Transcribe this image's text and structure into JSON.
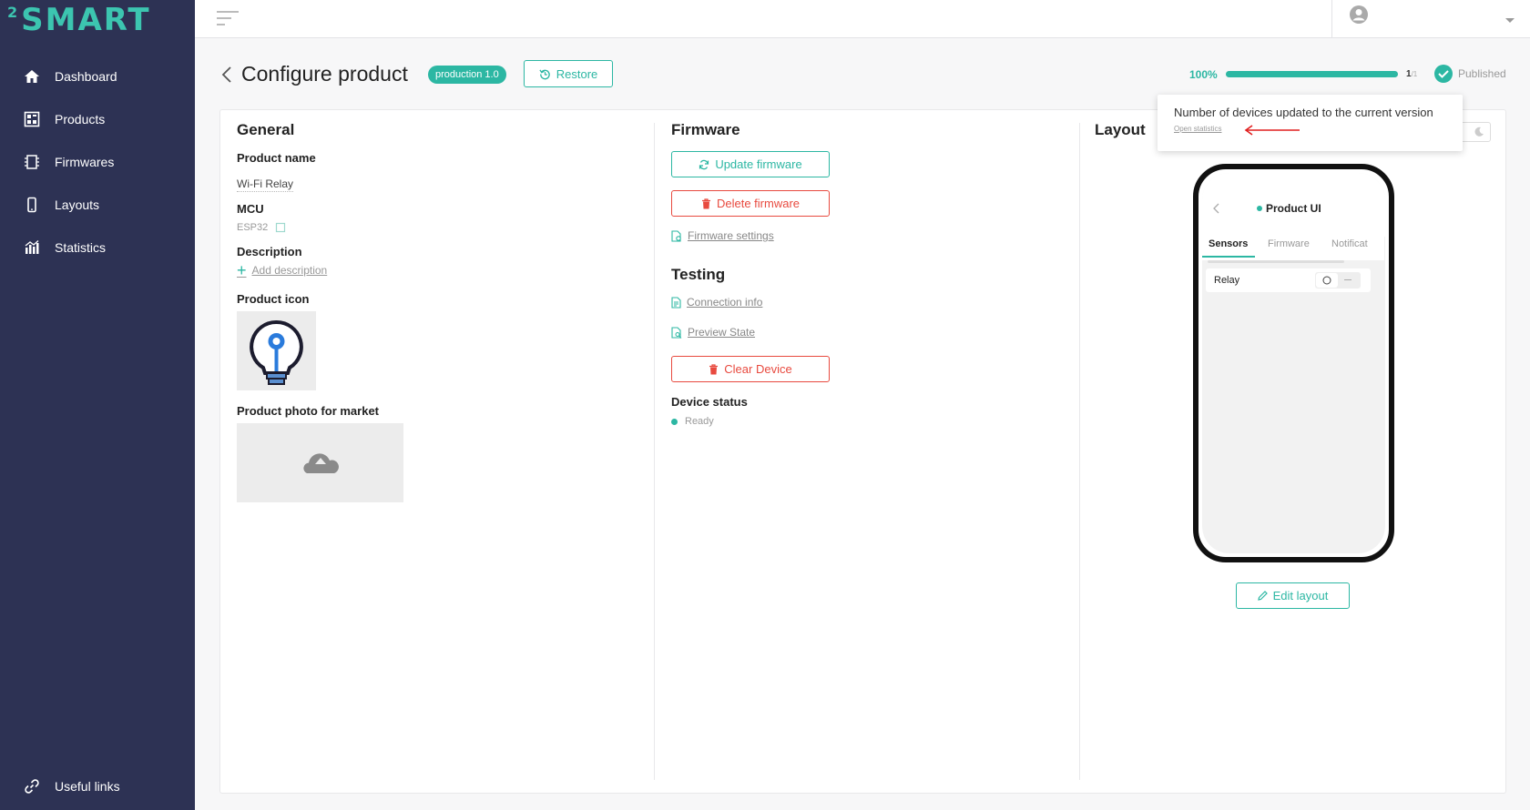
{
  "app": {
    "logo_sup": "2",
    "logo_text": "SMART"
  },
  "sidebar": {
    "items": [
      {
        "label": "Dashboard",
        "icon": "home-icon"
      },
      {
        "label": "Products",
        "icon": "products-icon"
      },
      {
        "label": "Firmwares",
        "icon": "firmware-icon"
      },
      {
        "label": "Layouts",
        "icon": "phone-icon"
      },
      {
        "label": "Statistics",
        "icon": "chart-icon"
      }
    ],
    "footer_link": "Useful links"
  },
  "header": {
    "title": "Configure product",
    "version_badge": "production 1.0",
    "restore_label": "Restore",
    "progress_percent_label": "100%",
    "progress_value": 1.0,
    "progress_count": "1",
    "progress_total": "/1",
    "published_label": "Published"
  },
  "tooltip": {
    "text": "Number of devices updated to the current version",
    "link": "Open statistics"
  },
  "general": {
    "title": "General",
    "product_name_label": "Product name",
    "product_name_value": "Wi-Fi Relay",
    "mcu_label": "MCU",
    "mcu_value": "ESP32",
    "description_label": "Description",
    "add_description": "Add description",
    "product_icon_label": "Product icon",
    "product_photo_label": "Product photo for market"
  },
  "firmware": {
    "title": "Firmware",
    "update_label": "Update firmware",
    "delete_label": "Delete firmware",
    "settings_link": "Firmware settings"
  },
  "testing": {
    "title": "Testing",
    "connection_info": "Connection info",
    "preview_state": "Preview State",
    "clear_device": "Clear Device",
    "device_status_label": "Device status",
    "device_status_value": "Ready"
  },
  "layout": {
    "title": "Layout",
    "phone_title": "Product UI",
    "tabs": [
      "Sensors",
      "Firmware",
      "Notificat"
    ],
    "row_label": "Relay",
    "edit_layout": "Edit layout"
  },
  "colors": {
    "accent": "#2cb7a3",
    "danger": "#e84a3f",
    "sidebar": "#2d3254"
  }
}
